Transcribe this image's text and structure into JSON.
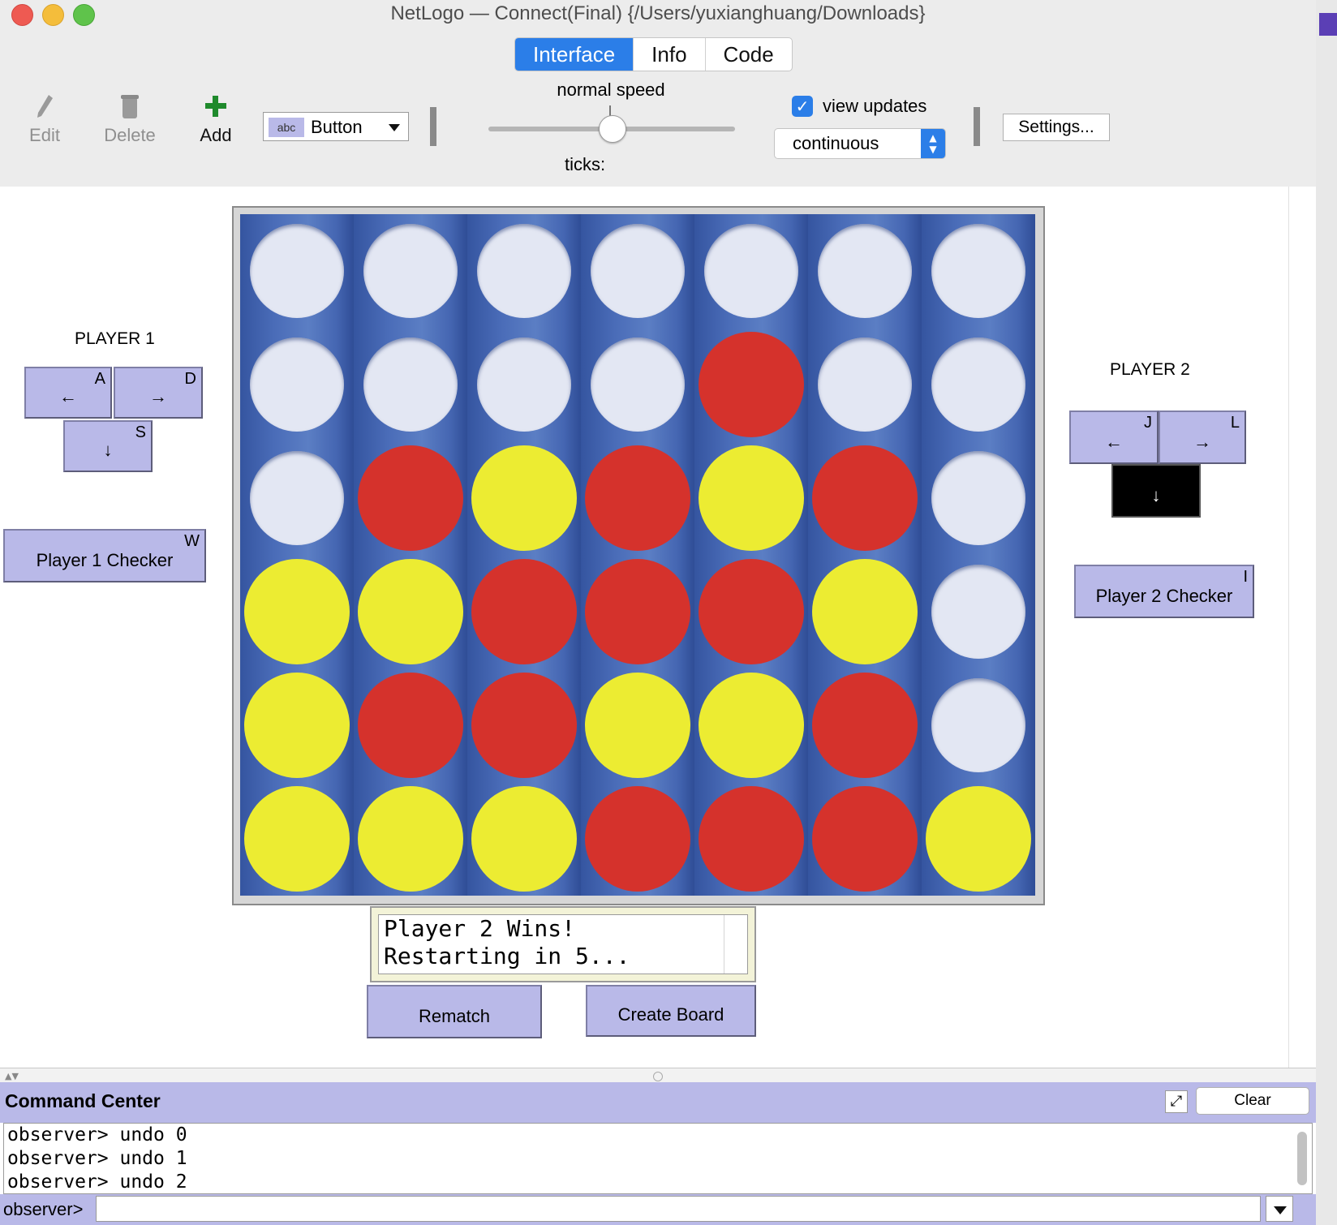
{
  "window": {
    "title": "NetLogo — Connect(Final) {/Users/yuxianghuang/Downloads}"
  },
  "tabs": [
    {
      "label": "Interface",
      "active": true
    },
    {
      "label": "Info",
      "active": false
    },
    {
      "label": "Code",
      "active": false
    }
  ],
  "toolbar": {
    "edit_label": "Edit",
    "delete_label": "Delete",
    "add_label": "Add",
    "widget_type": "Button",
    "widget_icon_text": "abc",
    "speed_label": "normal speed",
    "speed_value": 0.5,
    "ticks_label": "ticks:",
    "view_updates_label": "view updates",
    "view_updates_checked": true,
    "update_mode": "continuous",
    "settings_label": "Settings..."
  },
  "player1": {
    "title": "PLAYER 1",
    "left": {
      "label": "←",
      "key": "A"
    },
    "right": {
      "label": "→",
      "key": "D"
    },
    "down": {
      "label": "↓",
      "key": "S"
    },
    "checker": {
      "label": "Player 1 Checker",
      "key": "W"
    }
  },
  "player2": {
    "title": "PLAYER 2",
    "left": {
      "label": "←",
      "key": "J"
    },
    "right": {
      "label": "→",
      "key": "L"
    },
    "down": {
      "label": "↓",
      "key": "",
      "pressed": true
    },
    "checker": {
      "label": "Player 2 Checker",
      "key": "I"
    }
  },
  "board": {
    "rows": 6,
    "cols": 7,
    "colors": {
      "empty": "#e3e7f3",
      "red": "#d5322c",
      "yellow": "#ecec32",
      "board": "#3a5ca8"
    },
    "cells": [
      [
        "empty",
        "empty",
        "empty",
        "empty",
        "empty",
        "empty",
        "empty"
      ],
      [
        "empty",
        "empty",
        "empty",
        "empty",
        "red",
        "empty",
        "empty"
      ],
      [
        "empty",
        "red",
        "yellow",
        "red",
        "yellow",
        "red",
        "empty"
      ],
      [
        "yellow",
        "yellow",
        "red",
        "red",
        "red",
        "yellow",
        "empty"
      ],
      [
        "yellow",
        "red",
        "red",
        "yellow",
        "yellow",
        "red",
        "empty"
      ],
      [
        "yellow",
        "yellow",
        "yellow",
        "red",
        "red",
        "red",
        "yellow"
      ]
    ]
  },
  "message": {
    "line1": "Player 2 Wins!",
    "line2": "Restarting in 5..."
  },
  "buttons": {
    "rematch": "Rematch",
    "create_board": "Create Board"
  },
  "command_center": {
    "title": "Command Center",
    "clear_label": "Clear",
    "output": [
      "observer> undo 0",
      "observer> undo 1",
      "observer> undo 2"
    ],
    "prompt": "observer>",
    "input_value": ""
  }
}
